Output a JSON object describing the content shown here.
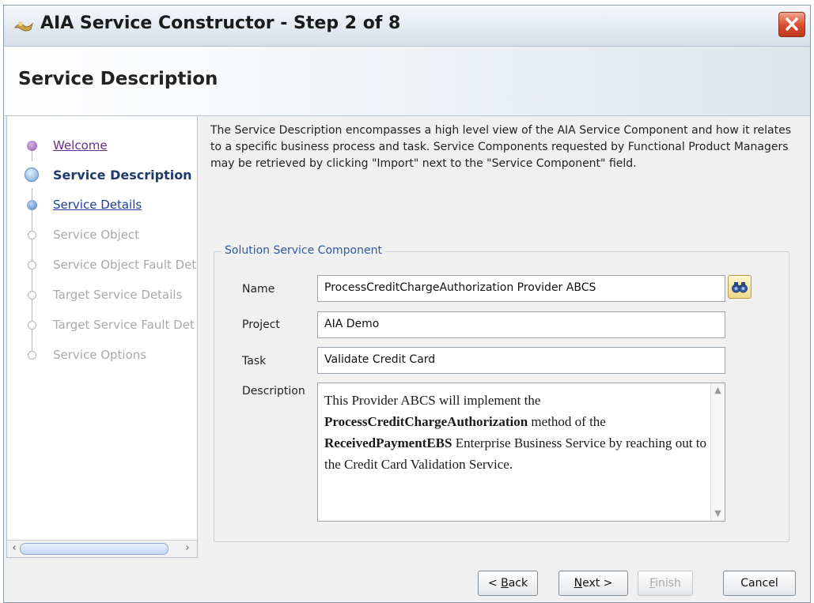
{
  "window": {
    "title": "AIA Service Constructor - Step 2 of 8"
  },
  "header": {
    "title": "Service Description"
  },
  "nav": {
    "items": [
      {
        "label": "Welcome",
        "state": "visited"
      },
      {
        "label": "Service Description",
        "state": "current"
      },
      {
        "label": "Service Details",
        "state": "link"
      },
      {
        "label": "Service Object",
        "state": "disabled"
      },
      {
        "label": "Service Object Fault Det",
        "state": "disabled"
      },
      {
        "label": "Target Service Details",
        "state": "disabled"
      },
      {
        "label": "Target Service Fault Det",
        "state": "disabled"
      },
      {
        "label": "Service Options",
        "state": "disabled"
      }
    ]
  },
  "content": {
    "description": "The Service Description encompasses a high level view of the AIA Service Component and how it relates to a specific business process and task. Service Components requested by Functional Product Managers may be retrieved by clicking \"Import\" next to the \"Service Component\" field."
  },
  "group": {
    "legend": "Solution Service Component",
    "name_label": "Name",
    "name_value": "ProcessCreditChargeAuthorization Provider ABCS",
    "project_label": "Project",
    "project_value": "AIA Demo",
    "task_label": "Task",
    "task_value": "Validate Credit Card",
    "description_label": "Description",
    "description_parts": {
      "p1": "This Provider ABCS will implement the ",
      "b1": "ProcessCreditChargeAuthorization",
      "p2": " method of the ",
      "b2": "ReceivedPaymentEBS",
      "p3": " Enterprise Business Service by reaching out to the Credit Card Validation Service."
    }
  },
  "buttons": {
    "back": {
      "prefix": "< ",
      "mnemonic": "B",
      "rest": "ack"
    },
    "next": {
      "mnemonic": "N",
      "rest": "ext >"
    },
    "finish": {
      "mnemonic": "F",
      "rest": "inish"
    },
    "cancel": "Cancel"
  },
  "icons": {
    "title": "wizard-app-icon",
    "close": "close-icon",
    "search": "search-binoculars-icon"
  },
  "colors": {
    "accent": "#2f5a9a",
    "close": "#d84b2c",
    "visited_link": "#6a2d8a",
    "link": "#1e3f9c"
  }
}
